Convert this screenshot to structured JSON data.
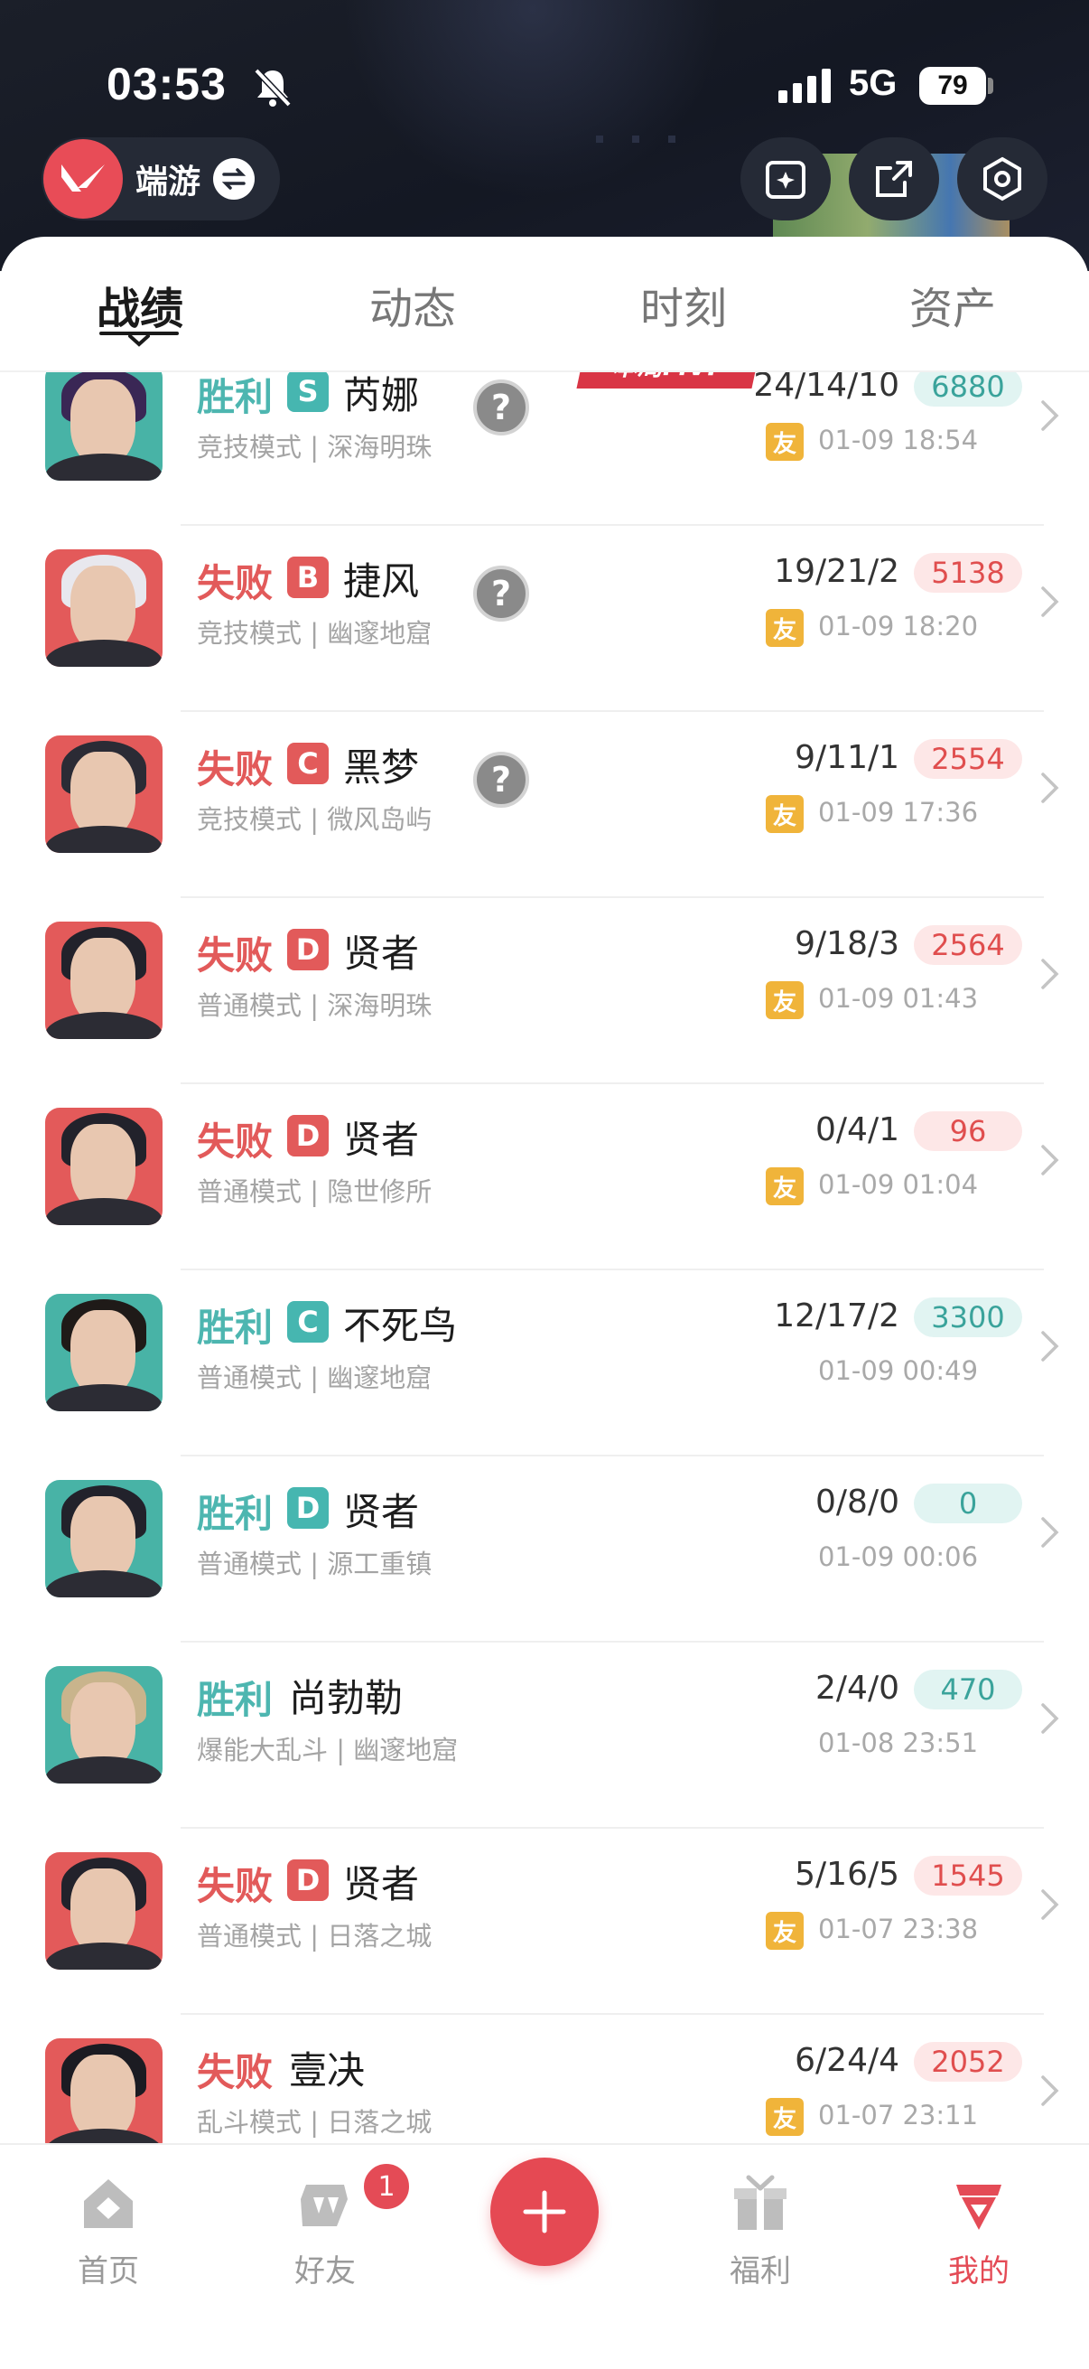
{
  "status_bar": {
    "time": "03:53",
    "network": "5G",
    "battery": "79"
  },
  "header": {
    "app_name": "端游"
  },
  "tabs": [
    {
      "label": "战绩",
      "active": true
    },
    {
      "label": "动态",
      "active": false
    },
    {
      "label": "时刻",
      "active": false
    },
    {
      "label": "资产",
      "active": false
    }
  ],
  "matches": [
    {
      "result": "胜利",
      "outcome": "win",
      "grade": "S",
      "grade_color": "#46b6b0",
      "agent": "芮娜",
      "mode": "竞技模式 | 深海明珠",
      "mvp": "本局MVP",
      "kda": "24/14/10",
      "score": "6880",
      "friend": "友",
      "datetime": "01-09 18:54",
      "avatar_bg": "#48b3a6",
      "hair": "#3a2755"
    },
    {
      "result": "失败",
      "outcome": "loss",
      "grade": "B",
      "grade_color": "#e25a5a",
      "agent": "捷风",
      "mode": "竞技模式 | 幽邃地窟",
      "kda": "19/21/2",
      "score": "5138",
      "friend": "友",
      "datetime": "01-09 18:20",
      "avatar_bg": "#e35a5a",
      "hair": "#e8e8ee"
    },
    {
      "result": "失败",
      "outcome": "loss",
      "grade": "C",
      "grade_color": "#e25a5a",
      "agent": "黑梦",
      "mode": "竞技模式 | 微风岛屿",
      "kda": "9/11/1",
      "score": "2554",
      "friend": "友",
      "datetime": "01-09 17:36",
      "avatar_bg": "#e35a5a",
      "hair": "#2b2b35"
    },
    {
      "result": "失败",
      "outcome": "loss",
      "grade": "D",
      "grade_color": "#e25a5a",
      "agent": "贤者",
      "mode": "普通模式 | 深海明珠",
      "kda": "9/18/3",
      "score": "2564",
      "friend": "友",
      "datetime": "01-09 01:43",
      "avatar_bg": "#e35a5a",
      "hair": "#22222b"
    },
    {
      "result": "失败",
      "outcome": "loss",
      "grade": "D",
      "grade_color": "#e25a5a",
      "agent": "贤者",
      "mode": "普通模式 | 隐世修所",
      "kda": "0/4/1",
      "score": "96",
      "friend": "友",
      "datetime": "01-09 01:04",
      "avatar_bg": "#e35a5a",
      "hair": "#22222b"
    },
    {
      "result": "胜利",
      "outcome": "win",
      "grade": "C",
      "grade_color": "#46b6b0",
      "agent": "不死鸟",
      "mode": "普通模式 | 幽邃地窟",
      "kda": "12/17/2",
      "score": "3300",
      "friend": "",
      "datetime": "01-09 00:49",
      "avatar_bg": "#48b3a6",
      "hair": "#1f1a18"
    },
    {
      "result": "胜利",
      "outcome": "win",
      "grade": "D",
      "grade_color": "#46b6b0",
      "agent": "贤者",
      "mode": "普通模式 | 源工重镇",
      "kda": "0/8/0",
      "score": "0",
      "friend": "",
      "datetime": "01-09 00:06",
      "avatar_bg": "#48b3a6",
      "hair": "#22222b"
    },
    {
      "result": "胜利",
      "outcome": "win",
      "grade": "",
      "grade_color": "#46b6b0",
      "agent": "尚勃勒",
      "mode": "爆能大乱斗 | 幽邃地窟",
      "kda": "2/4/0",
      "score": "470",
      "friend": "",
      "datetime": "01-08 23:51",
      "avatar_bg": "#48b3a6",
      "hair": "#c9b48c"
    },
    {
      "result": "失败",
      "outcome": "loss",
      "grade": "D",
      "grade_color": "#e25a5a",
      "agent": "贤者",
      "mode": "普通模式 | 日落之城",
      "kda": "5/16/5",
      "score": "1545",
      "friend": "友",
      "datetime": "01-07 23:38",
      "avatar_bg": "#e35a5a",
      "hair": "#22222b"
    },
    {
      "result": "失败",
      "outcome": "loss",
      "grade": "",
      "grade_color": "#e25a5a",
      "agent": "壹决",
      "mode": "乱斗模式 | 日落之城",
      "kda": "6/24/4",
      "score": "2052",
      "friend": "友",
      "datetime": "01-07 23:11",
      "avatar_bg": "#e35a5a",
      "hair": "#1b1b22"
    }
  ],
  "bottom_nav": {
    "home": "首页",
    "friends": "好友",
    "friends_badge": "1",
    "rewards": "福利",
    "me": "我的"
  },
  "colors": {
    "accent": "#e44b56",
    "win": "#4db6b0",
    "loss": "#e25a5a"
  }
}
